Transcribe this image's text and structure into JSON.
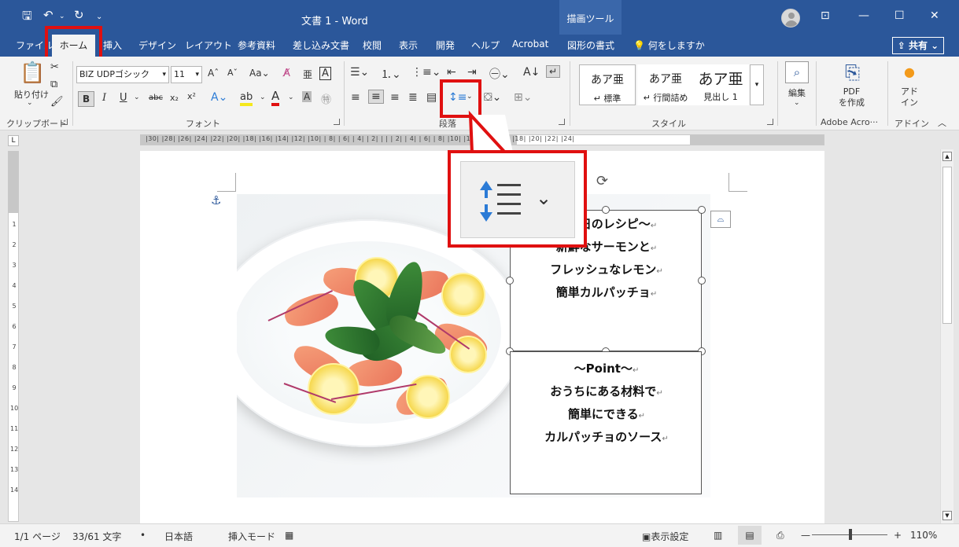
{
  "titlebar": {
    "title": "文書 1  -  Word",
    "context_tab_group": "描画ツール"
  },
  "tabs": {
    "file": "ファイル",
    "home": "ホーム",
    "insert": "挿入",
    "design": "デザイン",
    "layout": "レイアウト",
    "references": "参考資料",
    "mailings": "差し込み文書",
    "review": "校閲",
    "view": "表示",
    "developer": "開発",
    "help": "ヘルプ",
    "acrobat": "Acrobat",
    "shape_format": "図形の書式",
    "search": "何をしますか",
    "share": "共有"
  },
  "ribbon": {
    "clipboard": {
      "paste": "貼り付け",
      "label": "クリップボード"
    },
    "font": {
      "name": "BIZ UDPゴシック",
      "size": "11",
      "label": "フォント"
    },
    "paragraph": {
      "label": "段落"
    },
    "styles": {
      "label": "スタイル",
      "items": [
        {
          "preview": "あア亜",
          "name": "標準"
        },
        {
          "preview": "あア亜",
          "name": "行間詰め"
        },
        {
          "preview": "あア亜",
          "name": "見出し 1"
        }
      ]
    },
    "editing": {
      "label": "編集"
    },
    "adobe": {
      "button": "PDF\nを作成",
      "label": "Adobe Acro···"
    },
    "addins": {
      "button": "アド\nイン",
      "label": "アドイン"
    }
  },
  "ruler": {
    "numbers": "|30|  |28|  |26|  |24|  |22|  |20|  |18|  |16|  |14|  |12|  |10|  | 8|  | 6|  | 4|  | 2|  |   |  | 2|  | 4|  | 6|  | 8|  |10|  |12|  |14|  |16|  |18|  |20|  |22|  |24|"
  },
  "document": {
    "textbox1": [
      "〜今日のレシピ〜",
      "新鮮なサーモンと",
      "フレッシュなレモン",
      "簡単カルパッチョ"
    ],
    "textbox2": [
      "〜Point〜",
      "おうちにある材料で",
      "簡単にできる",
      "カルパッチョのソース"
    ],
    "paragraph_mark": "↵"
  },
  "status": {
    "page": "1/1 ページ",
    "words": "33/61 文字",
    "language": "日本語",
    "mode": "挿入モード",
    "display_settings": "表示設定",
    "zoom": "110%"
  },
  "colors": {
    "brand": "#2b579a",
    "highlight": "#e01010"
  }
}
